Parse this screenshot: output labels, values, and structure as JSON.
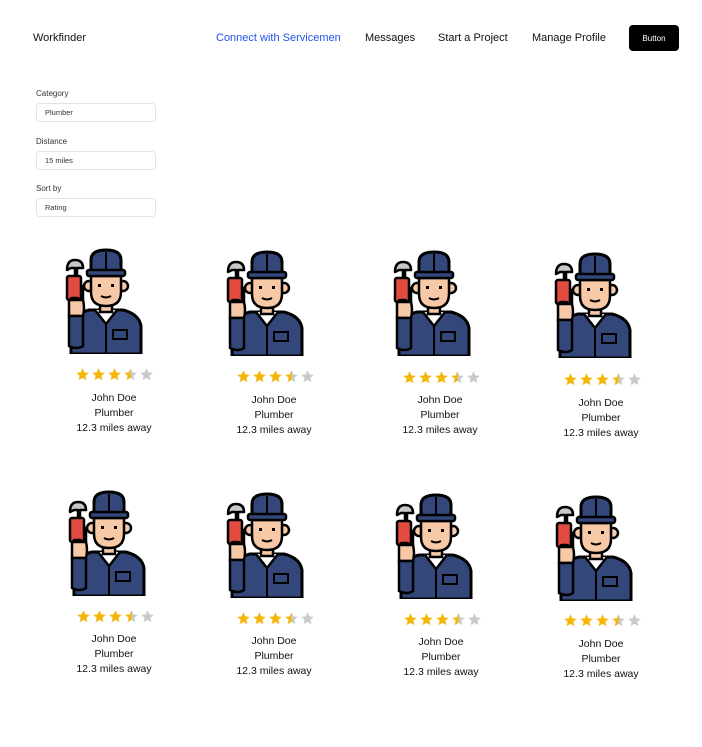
{
  "brand": "Workfinder",
  "nav": {
    "links": [
      "Connect with Servicemen",
      "Messages",
      "Start a Project",
      "Manage Profile"
    ],
    "button": "Button"
  },
  "filters": {
    "category": {
      "label": "Category",
      "value": "Plumber"
    },
    "distance": {
      "label": "Distance",
      "value": "15 miles"
    },
    "sort": {
      "label": "Sort by",
      "value": "Rating"
    }
  },
  "cards": [
    {
      "name": "John Doe",
      "role": "Plumber",
      "distance": "12.3 miles away",
      "rating": 3.5
    },
    {
      "name": "John Doe",
      "role": "Plumber",
      "distance": "12.3 miles away",
      "rating": 3.5
    },
    {
      "name": "John Doe",
      "role": "Plumber",
      "distance": "12.3 miles away",
      "rating": 3.5
    },
    {
      "name": "John Doe",
      "role": "Plumber",
      "distance": "12.3 miles away",
      "rating": 3.5
    },
    {
      "name": "John Doe",
      "role": "Plumber",
      "distance": "12.3 miles away",
      "rating": 3.5
    },
    {
      "name": "John Doe",
      "role": "Plumber",
      "distance": "12.3 miles away",
      "rating": 3.5
    },
    {
      "name": "John Doe",
      "role": "Plumber",
      "distance": "12.3 miles away",
      "rating": 3.5
    },
    {
      "name": "John Doe",
      "role": "Plumber",
      "distance": "12.3 miles away",
      "rating": 3.5
    }
  ],
  "colors": {
    "accent": "#2352e8",
    "star_filled": "#f5b60a",
    "star_empty": "#c9c9c9",
    "uniform": "#34477a",
    "skin": "#f7c9a6",
    "wrench": "#e24b3f"
  },
  "icons": {
    "avatar": "plumber-avatar-icon",
    "star": "star-icon"
  }
}
